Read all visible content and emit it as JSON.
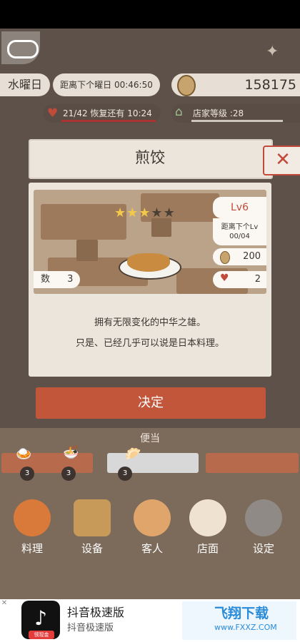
{
  "status": {
    "weekday": "水曜日",
    "countdown": "距离下个曜日 00:46:50",
    "money": "158175",
    "hp_text": "21/42 恢复还有 10:24",
    "shop_rank": "店家等级 :28"
  },
  "dialog": {
    "title": "煎饺",
    "rating_stars": 3,
    "rating_max": 5,
    "level": "Lv6",
    "next_level_label": "距离下个Lv",
    "next_level_progress": "00/04",
    "price": "200",
    "hearts": "2",
    "count_label": "数",
    "count_value": "3",
    "description_line1": "拥有无限变化的中华之雄。",
    "description_line2": "只是、已经几乎可以说是日本料理。",
    "confirm_label": "决定"
  },
  "counter": {
    "label": "便当",
    "badges": [
      "3",
      "3",
      "3"
    ]
  },
  "nav": [
    {
      "label": "料理",
      "icon": "cooking-icon"
    },
    {
      "label": "设备",
      "icon": "shop-building-icon"
    },
    {
      "label": "客人",
      "icon": "customers-icon"
    },
    {
      "label": "店面",
      "icon": "maneki-neko-icon"
    },
    {
      "label": "设定",
      "icon": "gear-icon"
    }
  ],
  "ad": {
    "app_title": "抖音极速版",
    "app_subtitle": "抖音极速版",
    "app_tag": "领现金",
    "brand_title": "飞翔下载",
    "brand_url": "www.FXXZ.COM"
  },
  "colors": {
    "accent": "#c2563b",
    "panel": "#ece5dc",
    "star_on": "#f3c94c",
    "heart": "#c14a3b"
  }
}
